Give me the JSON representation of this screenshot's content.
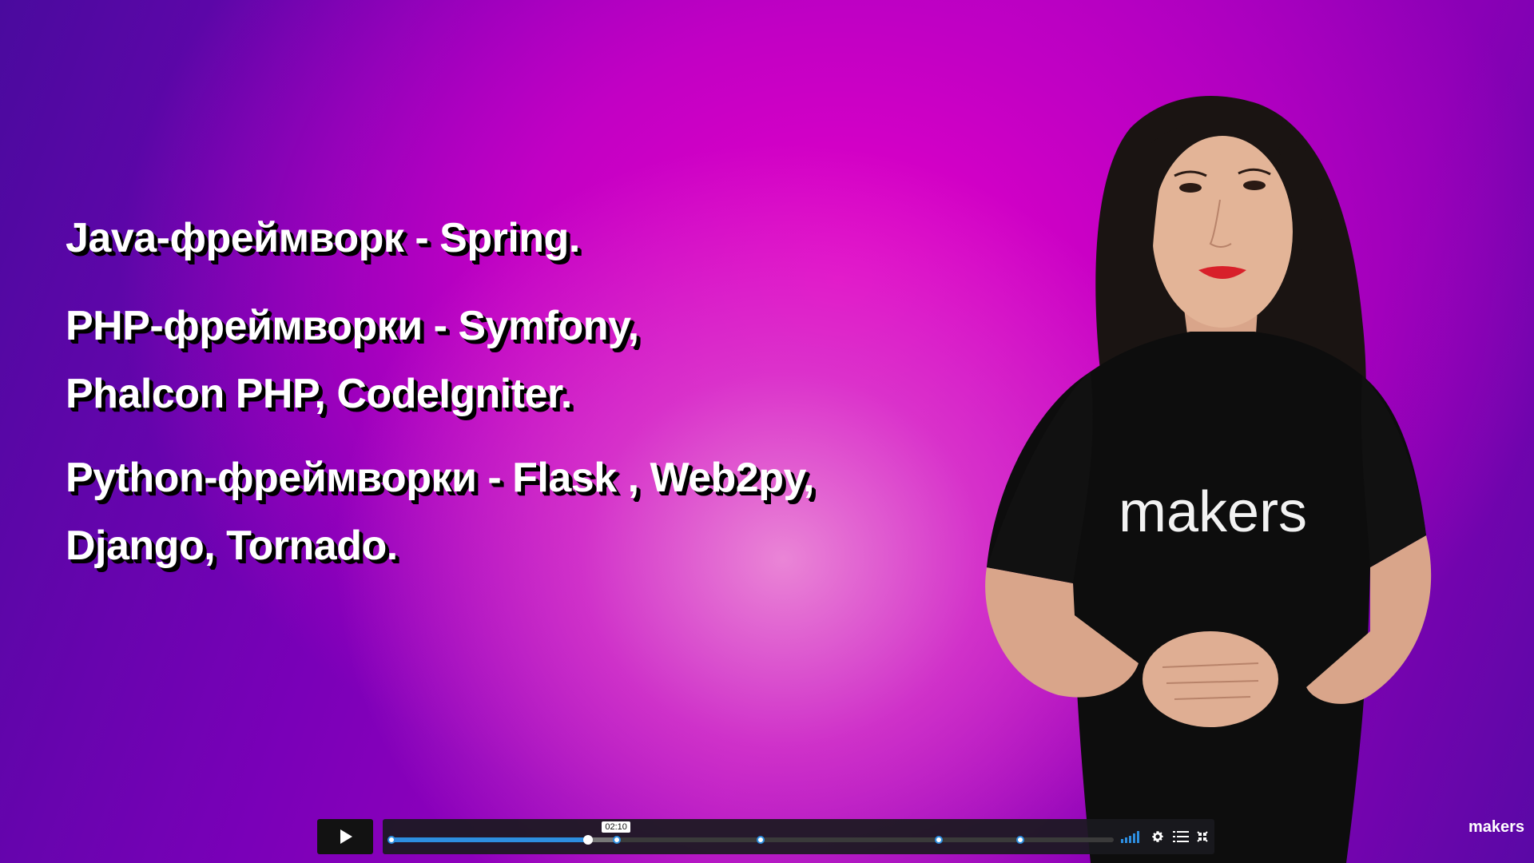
{
  "slide": {
    "lines": [
      "Java-фреймворк - Spring.",
      "PHP-фреймворки - Symfony,",
      "Phalcon PHP,  CodeIgniter.",
      "Python-фреймворки - Flask , Web2py,",
      "Django, Tornado."
    ]
  },
  "presenter": {
    "shirt_text": "makers"
  },
  "player": {
    "time_tooltip": "02:10",
    "progress": 0.273,
    "buffered": 0.312,
    "chapter_marker_positions": [
      0.0,
      0.312,
      0.511,
      0.757,
      0.87
    ],
    "accent_color": "#2d8ee0",
    "icons": [
      "play-icon",
      "volume-bars-icon",
      "gear-icon",
      "list-icon",
      "fullscreen-exit-icon"
    ]
  },
  "watermark": {
    "text": "makers"
  }
}
